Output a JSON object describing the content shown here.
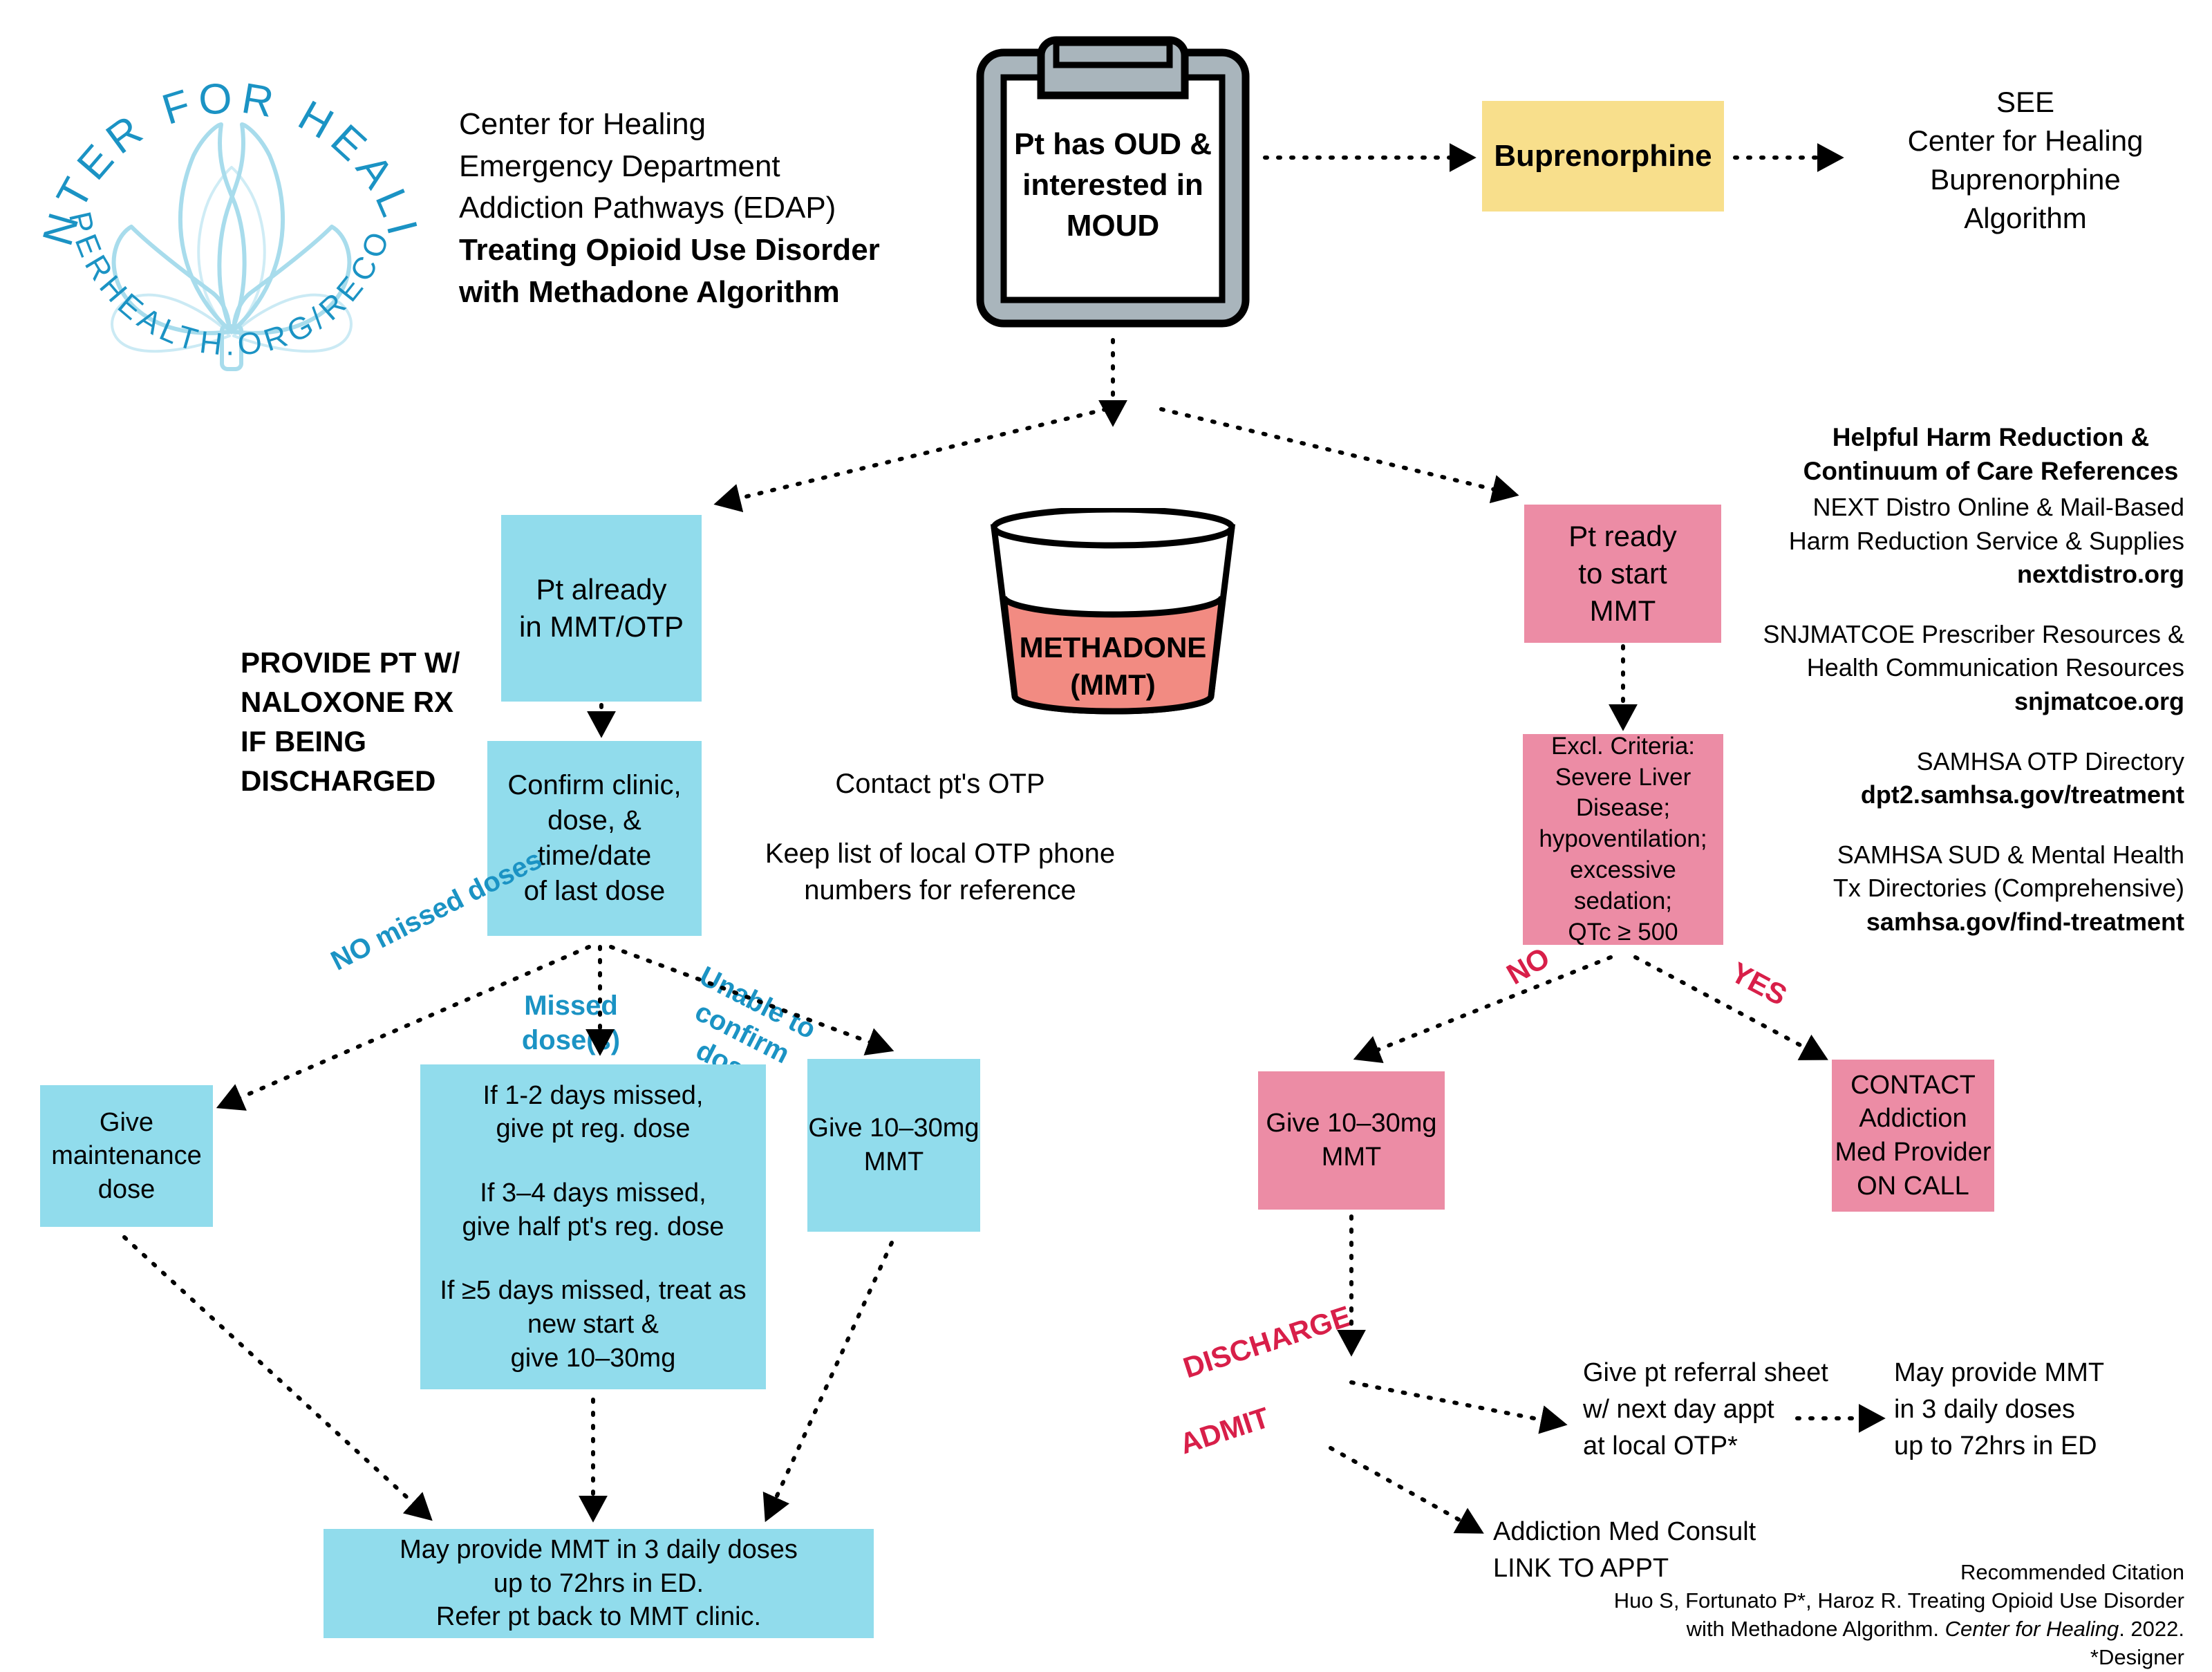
{
  "logo": {
    "top_arc_text": "CENTER FOR HEALING",
    "bottom_arc_text": "COOPERHEALTH.ORG/RECOVERY",
    "accent_color": "#1B93C4",
    "petal_color": "#A8DCEC"
  },
  "header": {
    "line1": "Center for Healing",
    "line2": "Emergency Department",
    "line3": "Addiction Pathways (EDAP)",
    "title_line1": "Treating Opioid Use Disorder",
    "title_line2": "with Methadone Algorithm"
  },
  "nodes": {
    "clipboard": {
      "line1": "Pt has OUD &",
      "line2": "interested in",
      "line3": "MOUD"
    },
    "buprenorphine": {
      "label": "Buprenorphine",
      "color": "#F8DF8C"
    },
    "see_bup": {
      "line1": "SEE",
      "line2": "Center for Healing",
      "line3": "Buprenorphine",
      "line4": "Algorithm"
    },
    "methadone_cup": {
      "line1": "METHADONE",
      "line2": "(MMT)",
      "liquid_color": "#F28B82"
    },
    "pt_already": {
      "line1": "Pt already",
      "line2": "in MMT/OTP",
      "color": "#91DCEC"
    },
    "naloxone_note": {
      "line1": "PROVIDE PT W/",
      "line2": "NALOXONE RX",
      "line3": "IF BEING",
      "line4": "DISCHARGED"
    },
    "confirm_clinic": {
      "line1": "Confirm clinic,",
      "line2": "dose, &",
      "line3": "time/date",
      "line4": "of last dose",
      "color": "#91DCEC"
    },
    "contact_otp": {
      "line1": "Contact pt's OTP",
      "line2": "Keep list of local OTP phone",
      "line3": "numbers for reference"
    },
    "pt_ready": {
      "line1": "Pt ready",
      "line2": "to start",
      "line3": "MMT",
      "color": "#EC8CA5"
    },
    "excl_criteria": {
      "line1": "Excl. Criteria:",
      "line2": "Severe Liver",
      "line3": "Disease;",
      "line4": "hypoventilation;",
      "line5": "excessive",
      "line6": "sedation;",
      "line7": "QTc ≥ 500",
      "color": "#EC8CA5"
    },
    "give_maintenance": {
      "line1": "Give",
      "line2": "maintenance",
      "line3": "dose",
      "color": "#91DCEC"
    },
    "missed_doses_rules": {
      "line1": "If 1-2 days missed,",
      "line2": "give pt reg. dose",
      "line3": "If 3–4 days missed,",
      "line4": "give half pt's reg. dose",
      "line5": "If ≥5 days missed, treat as",
      "line6": "new start &",
      "line7": "give 10–30mg",
      "color": "#91DCEC"
    },
    "give_1030_left": {
      "line1": "Give 10–30mg",
      "line2": "MMT",
      "color": "#91DCEC"
    },
    "give_1030_right": {
      "line1": "Give 10–30mg",
      "line2": "MMT",
      "color": "#EC8CA5"
    },
    "contact_addiction": {
      "line1": "CONTACT",
      "line2": "Addiction",
      "line3": "Med Provider",
      "line4": "ON CALL",
      "color": "#EC8CA5"
    },
    "may_provide_left": {
      "line1": "May provide MMT in 3 daily doses",
      "line2": "up to 72hrs in ED.",
      "line3": "Refer pt back to MMT clinic.",
      "color": "#91DCEC"
    },
    "referral_sheet": {
      "line1": "Give pt referral sheet",
      "line2": "w/ next day appt",
      "line3": "at local OTP*"
    },
    "may_provide_right": {
      "line1": "May provide MMT",
      "line2": "in 3 daily doses",
      "line3": "up to 72hrs in ED"
    },
    "addiction_consult": {
      "line1": "Addiction Med Consult",
      "line2": "LINK TO APPT"
    }
  },
  "edge_labels": {
    "no_missed_doses": "NO missed doses",
    "missed_dose_line1": "Missed",
    "missed_dose_line2": "dose(s)",
    "unable_line1": "Unable to",
    "unable_line2": "confirm dose",
    "no": "NO",
    "yes": "YES",
    "discharge": "DISCHARGE",
    "admit": "ADMIT",
    "blue_color": "#1B93C4",
    "red_color": "#D81F49"
  },
  "references": {
    "heading_line1": "Helpful Harm Reduction &",
    "heading_line2": "Continuum of Care References",
    "items": [
      {
        "line1": "NEXT Distro Online & Mail-Based",
        "line2": "Harm Reduction Service & Supplies",
        "url": "nextdistro.org"
      },
      {
        "line1": "SNJMATCOE Prescriber Resources &",
        "line2": "Health Communication Resources",
        "url": "snjmatcoe.org"
      },
      {
        "line1": "SAMHSA OTP Directory",
        "line2": "",
        "url": "dpt2.samhsa.gov/treatment"
      },
      {
        "line1": "SAMHSA SUD & Mental Health",
        "line2": "Tx Directories (Comprehensive)",
        "url": "samhsa.gov/find-treatment"
      }
    ]
  },
  "citation": {
    "heading": "Recommended Citation",
    "line1": "Huo S, Fortunato P*, Haroz R. Treating Opioid Use Disorder",
    "line2_pre": "with Methadone Algorithm. ",
    "line2_italic": "Center for Healing",
    "line2_post": ". 2022.",
    "line3": "*Designer"
  }
}
